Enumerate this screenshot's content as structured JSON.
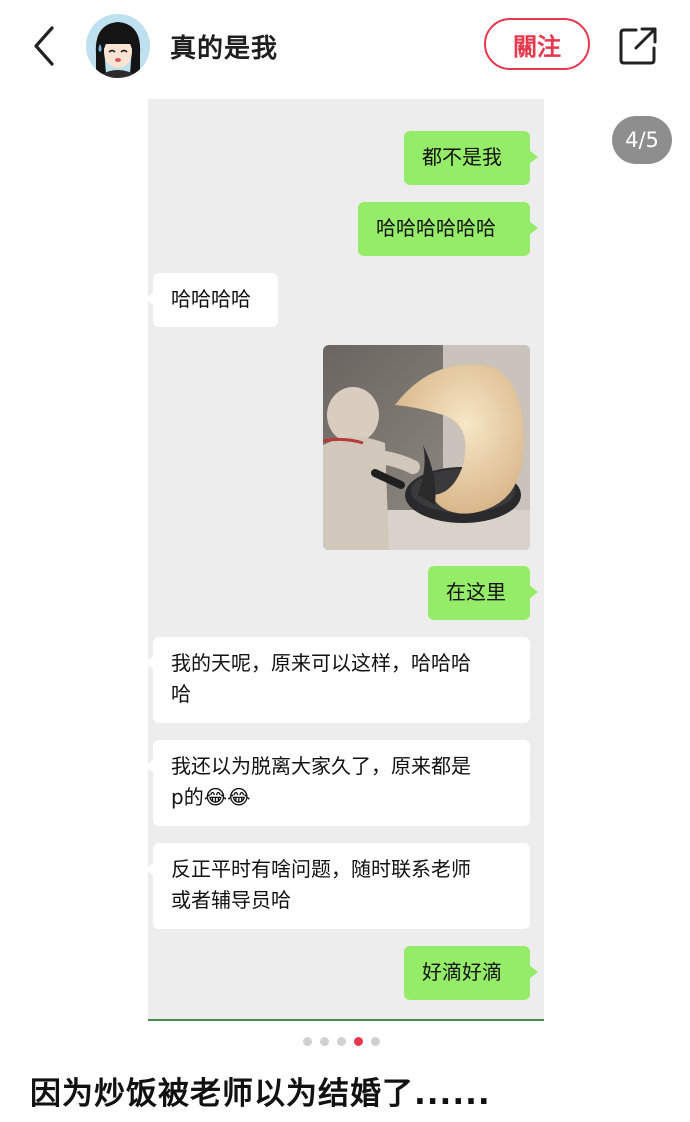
{
  "header": {
    "author_name": "真的是我",
    "follow_label": "關注"
  },
  "image_counter": "4/5",
  "chat": {
    "messages": [
      {
        "side": "me",
        "text": "都不是我"
      },
      {
        "side": "me",
        "text": "哈哈哈哈哈哈"
      },
      {
        "side": "other",
        "text": "哈哈哈哈"
      },
      {
        "side": "me",
        "type": "image"
      },
      {
        "side": "me",
        "text": "在这里"
      },
      {
        "side": "other",
        "line1": "我的天呢，原来可以这样，哈哈哈",
        "line2": "哈"
      },
      {
        "side": "other",
        "line1": "我还以为脱离大家久了，原来都是",
        "line2": "p的😂😂"
      },
      {
        "side": "other",
        "line1": "反正平时有啥问题，随时联系老师",
        "line2": "或者辅导员哈"
      },
      {
        "side": "me",
        "text": "好滴好滴"
      }
    ]
  },
  "carousel": {
    "total": 5,
    "active_index": 3
  },
  "post": {
    "title": "因为炒饭被老师以为结婚了......"
  },
  "colors": {
    "accent": "#e8384d",
    "bubble_me": "#95ec69",
    "bubble_other": "#ffffff",
    "chat_bg": "#ededed"
  },
  "icons": [
    "back-icon",
    "share-icon"
  ]
}
